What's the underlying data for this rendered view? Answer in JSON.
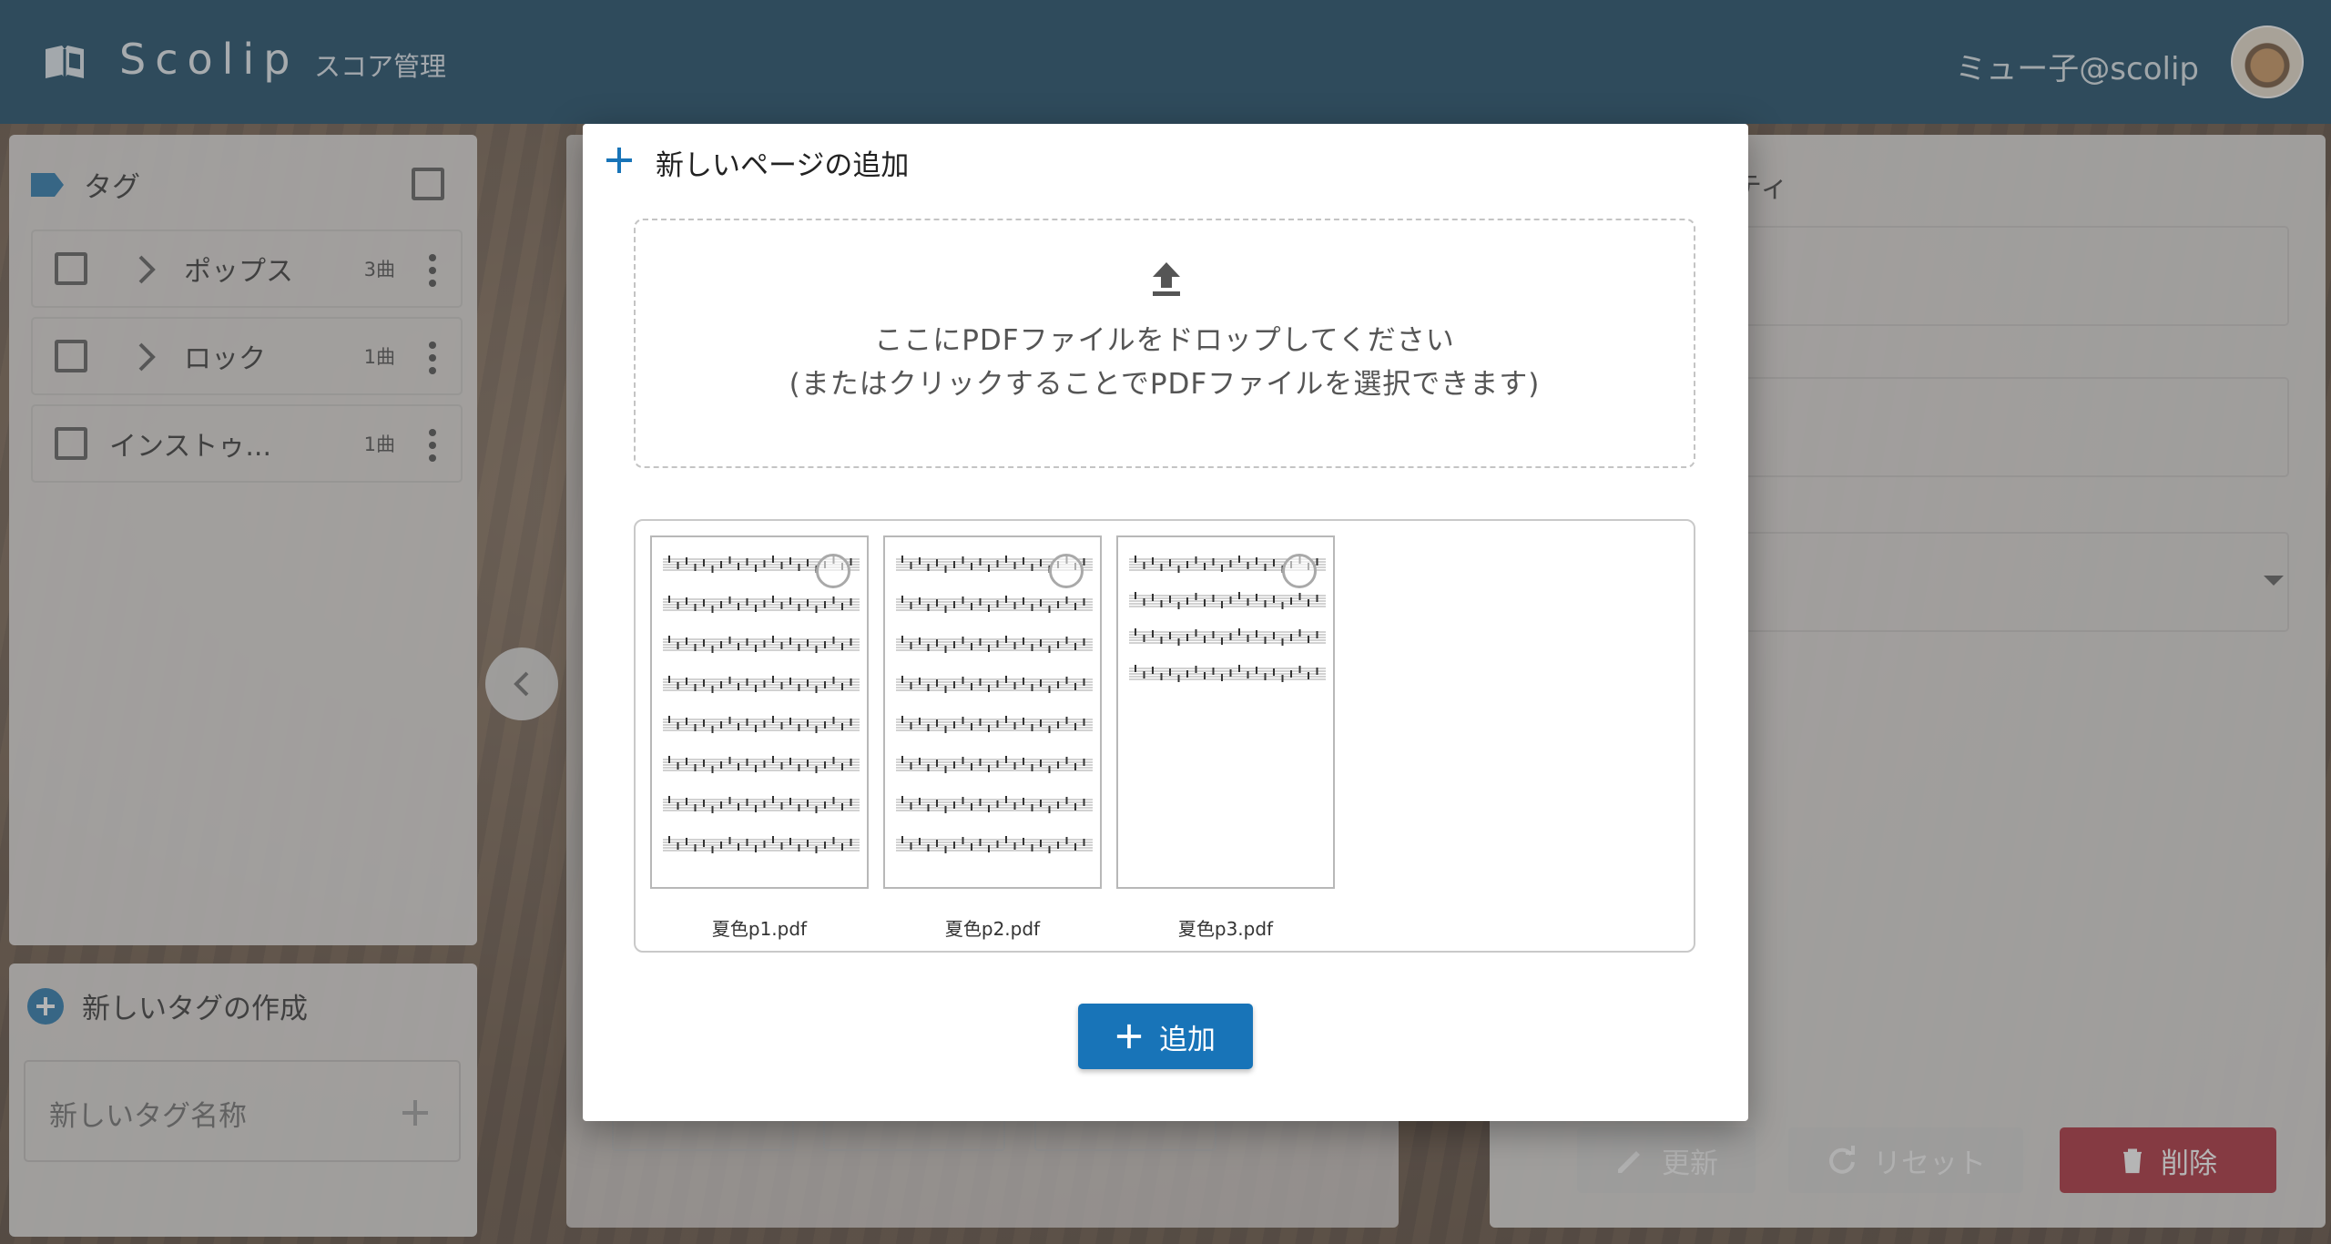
{
  "header": {
    "app_title": "Scolip",
    "nav_link": "スコア管理",
    "username": "ミュー子@scolip"
  },
  "tags": {
    "title": "タグ",
    "items": [
      {
        "name": "ポップス",
        "count": "3曲",
        "expandable": true
      },
      {
        "name": "ロック",
        "count": "1曲",
        "expandable": true
      },
      {
        "name": "インストゥ...",
        "count": "1曲",
        "expandable": false
      }
    ]
  },
  "new_tag": {
    "title": "新しいタグの作成",
    "placeholder": "新しいタグ名称"
  },
  "properties": {
    "title_fragment": "ティ",
    "update_label": "更新",
    "reset_label": "リセット",
    "delete_label": "削除"
  },
  "modal": {
    "title": "新しいページの追加",
    "drop_line1": "ここにPDFファイルをドロップしてください",
    "drop_line2": "(またはクリックすることでPDFファイルを選択できます)",
    "files": [
      {
        "name": "夏色p1.pdf"
      },
      {
        "name": "夏色p2.pdf"
      },
      {
        "name": "夏色p3.pdf"
      }
    ],
    "add_label": "追加"
  },
  "colors": {
    "header_bg": "#0b3f5e",
    "primary": "#1874b8",
    "danger": "#a81f2f"
  },
  "icons": [
    "book-open-icon",
    "label-icon",
    "chevron-right-icon",
    "more-vert-icon",
    "plus-icon",
    "upload-icon",
    "pencil-icon",
    "refresh-icon",
    "trash-icon",
    "chevron-left-icon"
  ]
}
